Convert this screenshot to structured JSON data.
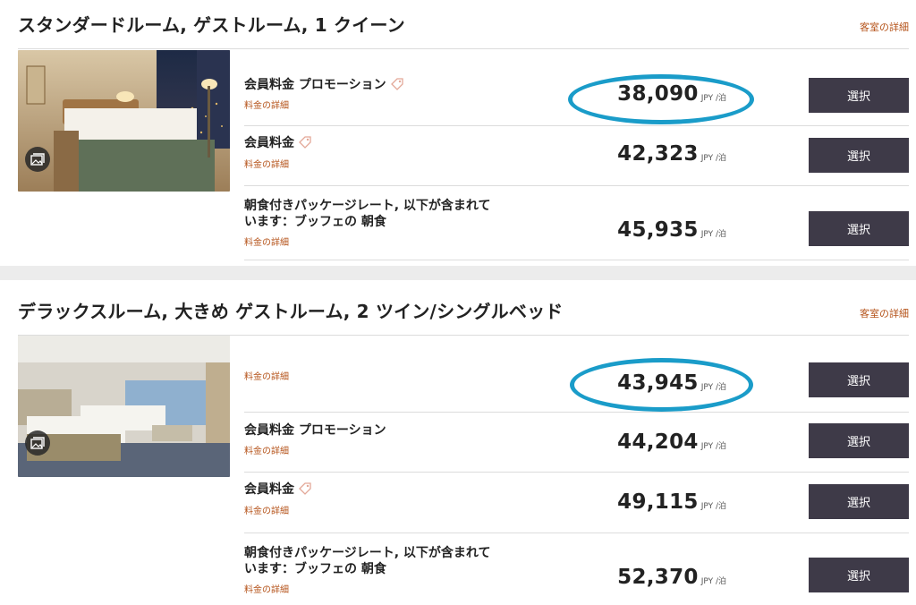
{
  "colors": {
    "accent_link": "#b5531a",
    "select_button": "#3e3a48",
    "highlight_oval": "#1a9cc9"
  },
  "rooms": [
    {
      "title": "スタンダードルーム, ゲストルーム, 1 クイーン",
      "details_link": "客室の詳細",
      "photo_icon": "photo-gallery-icon",
      "rates": [
        {
          "name": "会員料金 プロモーション",
          "tag_icon": "tag-icon",
          "link": "料金の詳細",
          "price": "38,090",
          "unit": "JPY /泊",
          "button": "選択",
          "highlighted": true
        },
        {
          "name": "会員料金",
          "tag_icon": "tag-icon",
          "link": "料金の詳細",
          "price": "42,323",
          "unit": "JPY /泊",
          "button": "選択"
        },
        {
          "name_line1": "朝食付きパッケージレート, 以下が含まれて",
          "name_line2": "います：ブッフェの 朝食",
          "link": "料金の詳細",
          "price": "45,935",
          "unit": "JPY /泊",
          "button": "選択"
        }
      ]
    },
    {
      "title": "デラックスルーム, 大きめ ゲストルーム, 2 ツイン/シングルベッド",
      "details_link": "客室の詳細",
      "photo_icon": "photo-gallery-icon",
      "rates": [
        {
          "link": "料金の詳細",
          "price": "43,945",
          "unit": "JPY /泊",
          "button": "選択",
          "highlighted": true
        },
        {
          "name": "会員料金 プロモーション",
          "link": "料金の詳細",
          "price": "44,204",
          "unit": "JPY /泊",
          "button": "選択"
        },
        {
          "name": "会員料金",
          "tag_icon": "tag-icon",
          "link": "料金の詳細",
          "price": "49,115",
          "unit": "JPY /泊",
          "button": "選択"
        },
        {
          "name_line1": "朝食付きパッケージレート, 以下が含まれて",
          "name_line2": "います：ブッフェの 朝食",
          "link": "料金の詳細",
          "price": "52,370",
          "unit": "JPY /泊",
          "button": "選択"
        }
      ]
    }
  ]
}
